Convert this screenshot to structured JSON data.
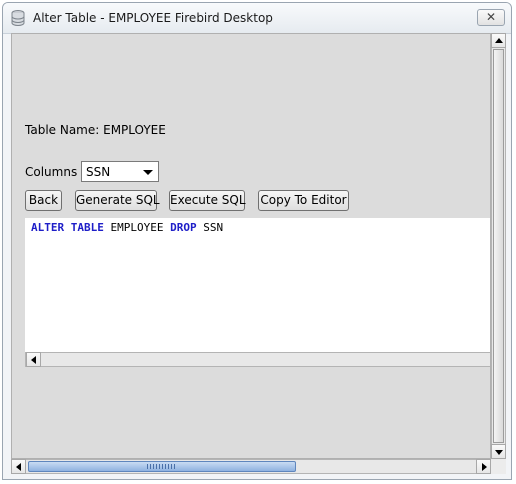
{
  "window": {
    "title": "Alter Table - EMPLOYEE Firebird Desktop",
    "close_glyph": "✕"
  },
  "form": {
    "table_name_label": "Table Name: EMPLOYEE",
    "columns_label": "Columns",
    "columns_selected": "SSN"
  },
  "buttons": {
    "back": "Back",
    "generate_sql": "Generate SQL",
    "execute_sql": "Execute SQL",
    "copy_to_editor": "Copy To Editor"
  },
  "sql": {
    "kw_alter": "ALTER",
    "kw_table": "TABLE",
    "table": "EMPLOYEE",
    "kw_drop": "DROP",
    "column": "SSN"
  },
  "colors": {
    "keyword": "#1e1ec8",
    "panel": "#dcdcdc",
    "scroll_thumb": "#8fb2e0"
  },
  "icons": {
    "app": "database-icon",
    "close": "close-icon"
  }
}
